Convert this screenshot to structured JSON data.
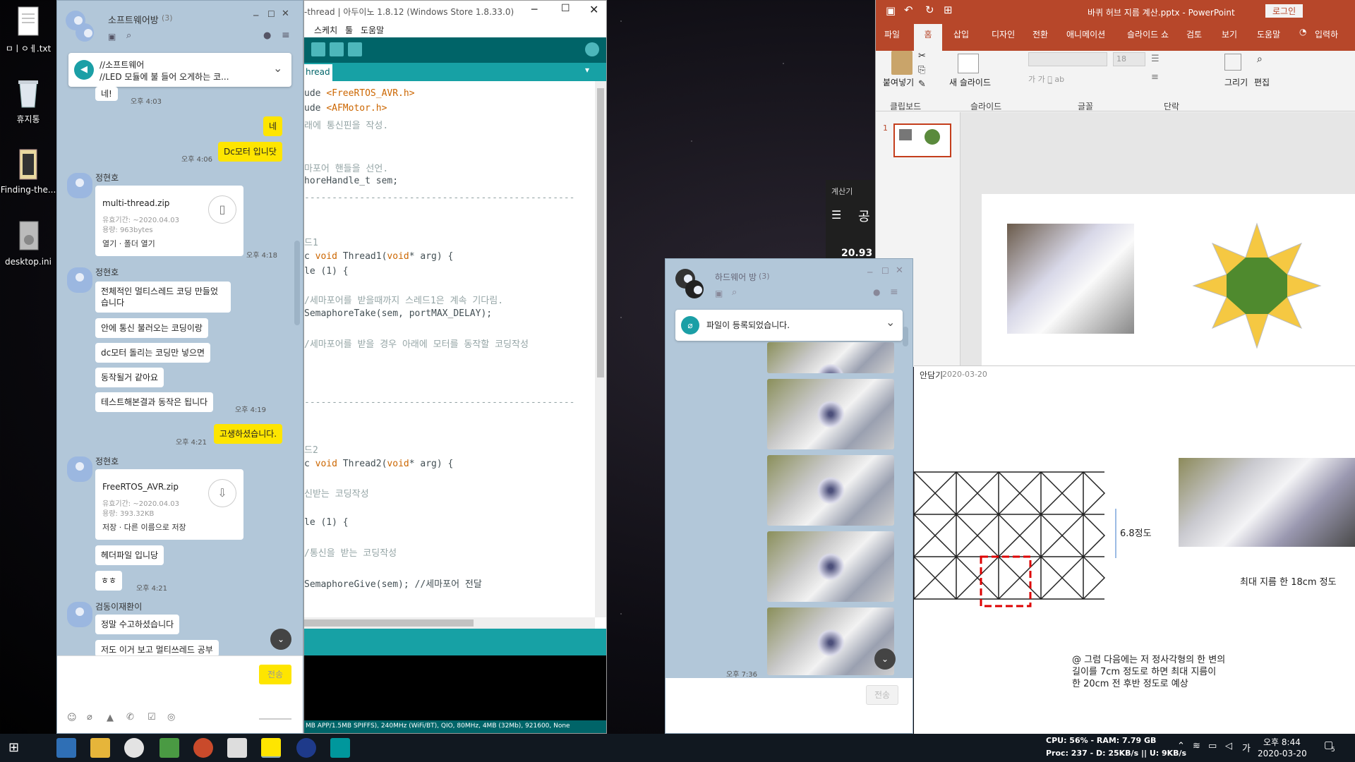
{
  "desktop": {
    "icons": [
      {
        "label": "ㅁㅣㅇㅔ.txt"
      },
      {
        "label": "휴지통"
      },
      {
        "label": "Finding-the..."
      },
      {
        "label": "desktop.ini"
      }
    ]
  },
  "kakao_main": {
    "room_name": "소프트웨어방",
    "member_count": "(3)",
    "notice": {
      "line1": "//소프트웨어",
      "line2": "//LED 모듈에 불 들어 오게하는 코..."
    },
    "messages": {
      "m1": {
        "text": "네!",
        "time": "오후 4:03"
      },
      "m2": {
        "text": "네"
      },
      "m3": {
        "text": "Dc모터 입니닷",
        "time": "오후 4:06"
      },
      "s1": "정현호",
      "f1": {
        "name": "multi-thread.zip",
        "expiry": "유효기간: ~2020.04.03",
        "size": "용량: 963bytes",
        "actions": "열기 · 폴더 열기",
        "time": "오후 4:18"
      },
      "s2": "정현호",
      "m4": {
        "text": "전체적인 멀티스레드 코딩 만들었\n습니다"
      },
      "m5": {
        "text": "안에 통신 불러오는 코딩이랑"
      },
      "m6": {
        "text": "dc모터 돌리는 코딩만 넣으면"
      },
      "m7": {
        "text": "동작될거 같아요"
      },
      "m8": {
        "text": "테스트해본결과 동작은 됩니다",
        "time": "오후 4:19"
      },
      "m9": {
        "text": "고생하셨습니다.",
        "time": "오후 4:21"
      },
      "s3": "정현호",
      "f2": {
        "name": "FreeRTOS_AVR.zip",
        "expiry": "유효기간: ~2020.04.03",
        "size": "용량: 393.32KB",
        "actions": "저장 · 다른 이름으로 저장"
      },
      "m10": {
        "text": "헤더파일 입니당"
      },
      "m11": {
        "text": "ㅎㅎ",
        "time": "오후 4:21"
      },
      "s4": "검동이재환이",
      "m12": {
        "text": "정말 수고하셨습니다"
      },
      "m13": {
        "text": "저도 이거 보고 멀티쓰레드 공부"
      }
    },
    "send_label": "전송"
  },
  "arduino": {
    "title": "-thread | 아두이노 1.8.12 (Windows Store 1.8.33.0)",
    "menu": [
      "스케치",
      "툴",
      "도움말"
    ],
    "tab": "hread",
    "code": {
      "l1a": "ude ",
      "l1b": "<FreeRTOS_AVR.h>",
      "l2a": "ude ",
      "l2b": "<AFMotor.h>",
      "l3": "래에 통신핀을 작성.",
      "l4": "마포어 핸들을 선언.",
      "l5": "horeHandle_t sem;",
      "sep": "-------------------------------------------------",
      "l6": "드1",
      "l7a": "c ",
      "l7b": "void",
      "l7c": " Thread1(",
      "l7d": "void",
      "l7e": "* arg) {",
      "l8": "le (1) {",
      "l9": "/세마포어를 받을때까지 스레드1은 계속 기다림.",
      "l10": "SemaphoreTake(sem, portMAX_DELAY);",
      "l11": "/세마포어를 받을 경우 아래에 모터를 동작할 코딩작성",
      "l12": "드2",
      "l13a": "c ",
      "l13b": "void",
      "l13c": " Thread2(",
      "l13d": "void",
      "l13e": "* arg) {",
      "l14": "신받는 코딩작성",
      "l15": "le (1) {",
      "l16": "/통신을 받는 코딩작성",
      "l17": "SemaphoreGive(sem); //세마포어 전달"
    },
    "status": "MB APP/1.5MB SPIFFS), 240MHz (WiFi/BT), QIO, 80MHz, 4MB (32Mb), 921600, None"
  },
  "calculator": {
    "title": "계산기",
    "value": "20.93",
    "mode": "공"
  },
  "kakao_hw": {
    "room_name": "하드웨어 방",
    "member_count": "(3)",
    "notice": "파일이 등록되었습니다.",
    "time": "오후 7:36",
    "send_label": "전송"
  },
  "powerpoint": {
    "title": "바퀴 허브 지름 계산.pptx - PowerPoint",
    "login": "로그인",
    "tabs": [
      "파일",
      "홈",
      "삽입",
      "디자인",
      "전환",
      "애니메이션",
      "슬라이드 쇼",
      "검토",
      "보기",
      "도움말"
    ],
    "search": "입력하",
    "groups": {
      "clipboard": "클립보드",
      "slides": "슬라이드",
      "font": "글꼴",
      "paragraph": "단락"
    },
    "buttons": {
      "paste": "붙여넣기",
      "new_slide": "새 슬라이드",
      "draw": "그리기",
      "edit": "편집"
    },
    "font_size": "18",
    "slide_num": "1"
  },
  "photo_note": {
    "author": "안담기",
    "date": "2020-03-20",
    "measure": "6.8정도",
    "max_diam": "최대 지름 한 18cm 정도",
    "note": "@ 그럼 다음에는 저 정사각형의 한 변의\n길이를 7cm 정도로 하면 최대 지름이\n한 20cm 전 후반 정도로 예상"
  },
  "taskbar": {
    "stats1": "CPU: 56% - RAM: 7.79 GB",
    "stats2": "Proc: 237 - D: 25KB/s || U: 9KB/s",
    "time": "오후 8:44",
    "date": "2020-03-20",
    "ime": "가",
    "notif": "5"
  }
}
